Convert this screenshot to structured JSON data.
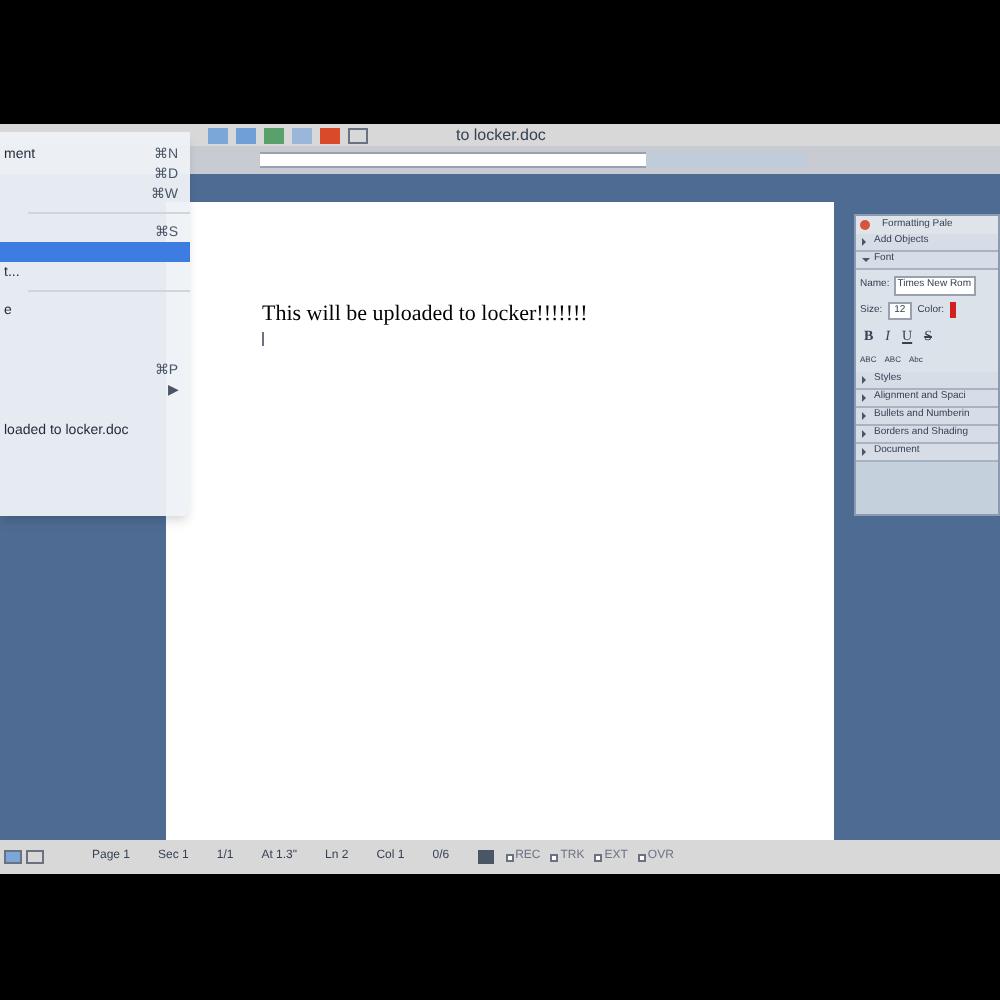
{
  "window": {
    "title": "to locker.doc"
  },
  "document": {
    "lines": [
      "This will be uploaded to locker!!!!!!!"
    ]
  },
  "file_menu": {
    "items": [
      {
        "label": "ment",
        "shortcut": "⌘N",
        "selected": false
      },
      {
        "shortcut": "⌘D",
        "selected": false
      },
      {
        "shortcut": "⌘W",
        "selected": false,
        "separator_after": true
      },
      {
        "shortcut": "⌘S",
        "selected": false
      },
      {
        "selected": true
      },
      {
        "label": "t...",
        "selected": false,
        "separator_after": true
      },
      {
        "label": "e",
        "selected": false
      },
      {
        "selected": false
      },
      {
        "selected": false
      },
      {
        "shortcut": "⌘P",
        "selected": false
      },
      {
        "shortcut": "▶",
        "selected": false
      },
      {
        "selected": false
      },
      {
        "label": "loaded to locker.doc",
        "selected": false
      }
    ]
  },
  "formatting_palette": {
    "title": "Formatting Pale",
    "sections_top": [
      {
        "label": "Add Objects",
        "expanded": false
      },
      {
        "label": "Font",
        "expanded": true
      }
    ],
    "font_name_label": "Name:",
    "font_name": "Times New Rom",
    "size_label": "Size:",
    "size": "12",
    "color_label": "Color:",
    "style_buttons": [
      "B",
      "I",
      "U",
      "S"
    ],
    "case_buttons": [
      "ABC",
      "ABC",
      "Abc"
    ],
    "sections_bottom": [
      {
        "label": "Styles",
        "expanded": false
      },
      {
        "label": "Alignment and Spaci",
        "expanded": false
      },
      {
        "label": "Bullets and Numberin",
        "expanded": false
      },
      {
        "label": "Borders and Shading",
        "expanded": false
      },
      {
        "label": "Document",
        "expanded": false
      }
    ]
  },
  "status_bar": {
    "fields": [
      "Page 1",
      "Sec 1",
      "1/1",
      "At 1.3\"",
      "Ln 2",
      "Col 1",
      "0/6"
    ],
    "modes": [
      {
        "label": "REC",
        "on": false
      },
      {
        "label": "TRK",
        "on": false
      },
      {
        "label": "EXT",
        "on": false
      },
      {
        "label": "OVR",
        "on": false
      }
    ]
  }
}
